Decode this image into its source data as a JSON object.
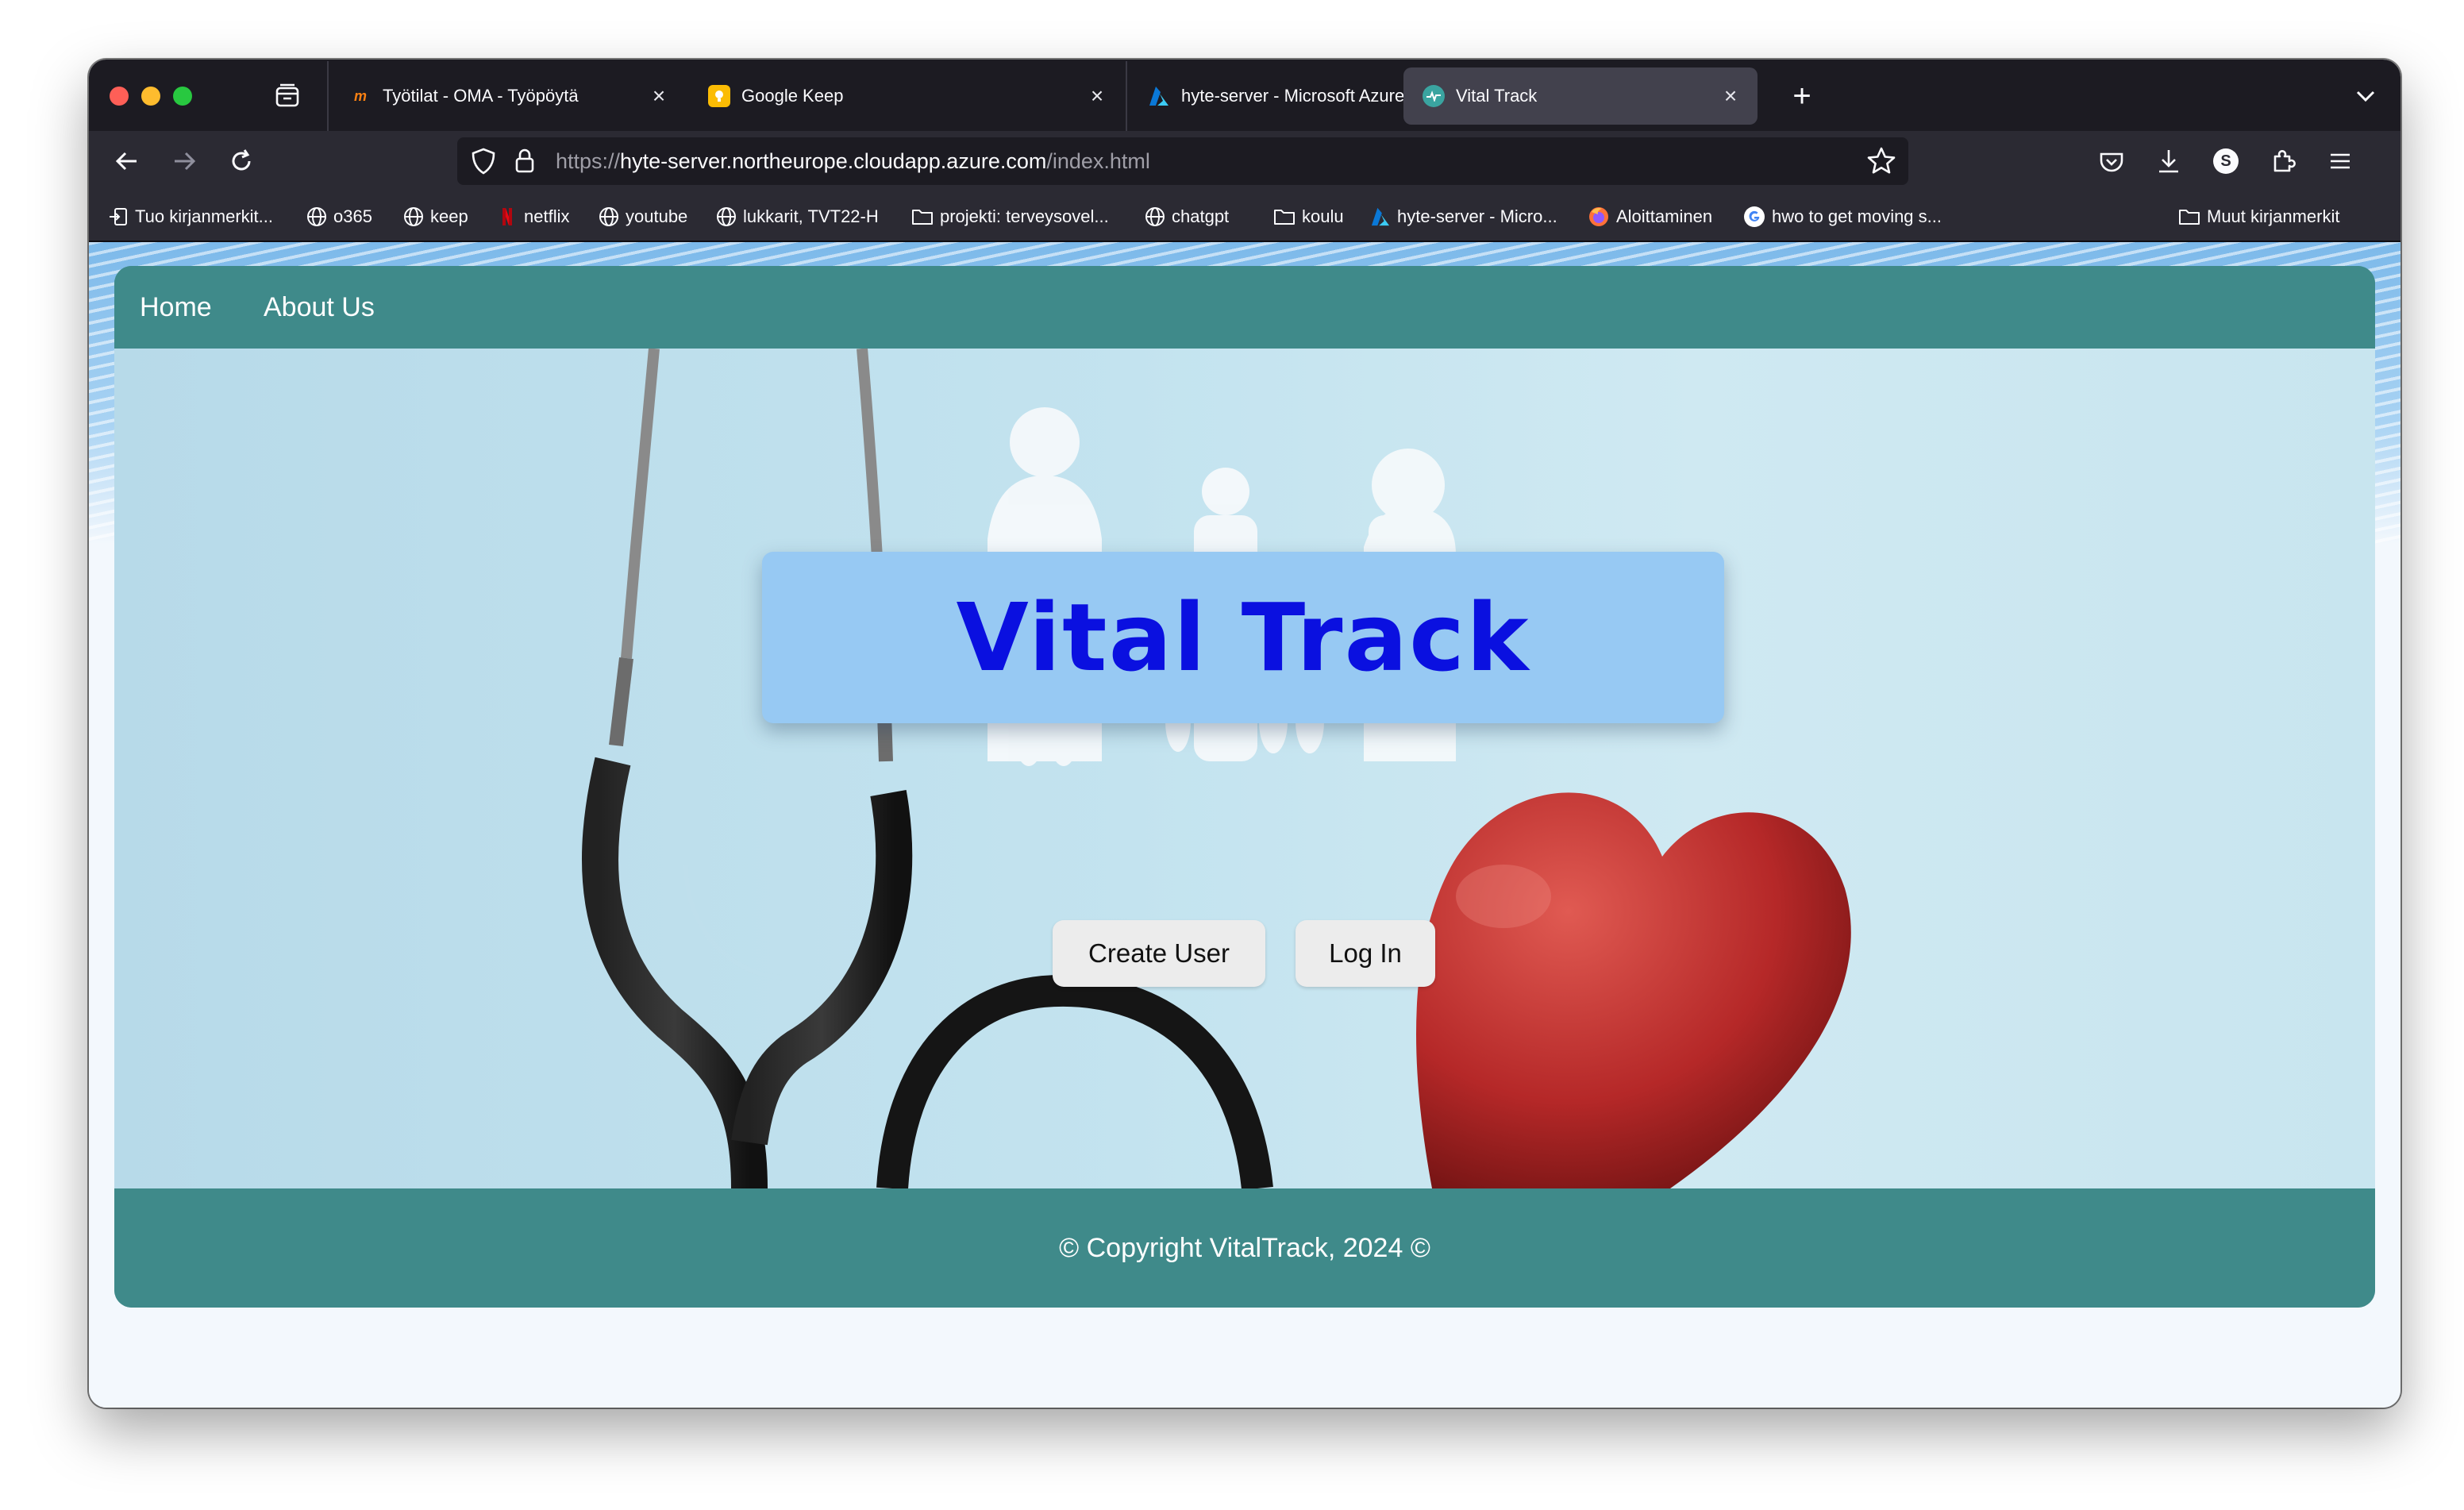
{
  "browser": {
    "tabs": [
      {
        "label": "Työtilat - OMA - Työpöytä",
        "active": false
      },
      {
        "label": "Google Keep",
        "active": false
      },
      {
        "label": "hyte-server - Microsoft Azure",
        "active": false
      },
      {
        "label": "Vital Track",
        "active": true
      }
    ],
    "url_prefix": "https://",
    "url_host": "hyte-server.northeurope.cloudapp.azure.com",
    "url_path": "/index.html",
    "bookmarks": [
      "Tuo kirjanmerkit...",
      "o365",
      "keep",
      "netflix",
      "youtube",
      "lukkarit, TVT22-H",
      "projekti: terveysovel...",
      "chatgpt",
      "koulu",
      "hyte-server - Micro...",
      "Aloittaminen",
      "hwo to get moving s..."
    ],
    "other_bookmarks": "Muut kirjanmerkit",
    "account_initial": "S"
  },
  "page": {
    "nav": {
      "home": "Home",
      "about": "About Us"
    },
    "title": "Vital Track",
    "buttons": {
      "create_user": "Create User",
      "log_in": "Log In"
    },
    "footer": "© Copyright VitalTrack, 2024 ©"
  },
  "colors": {
    "teal": "#3f8a8a",
    "title_box": "#97c9f3",
    "title_text": "#0a10e0",
    "button_bg": "#ececec",
    "heart": "#b52828"
  }
}
